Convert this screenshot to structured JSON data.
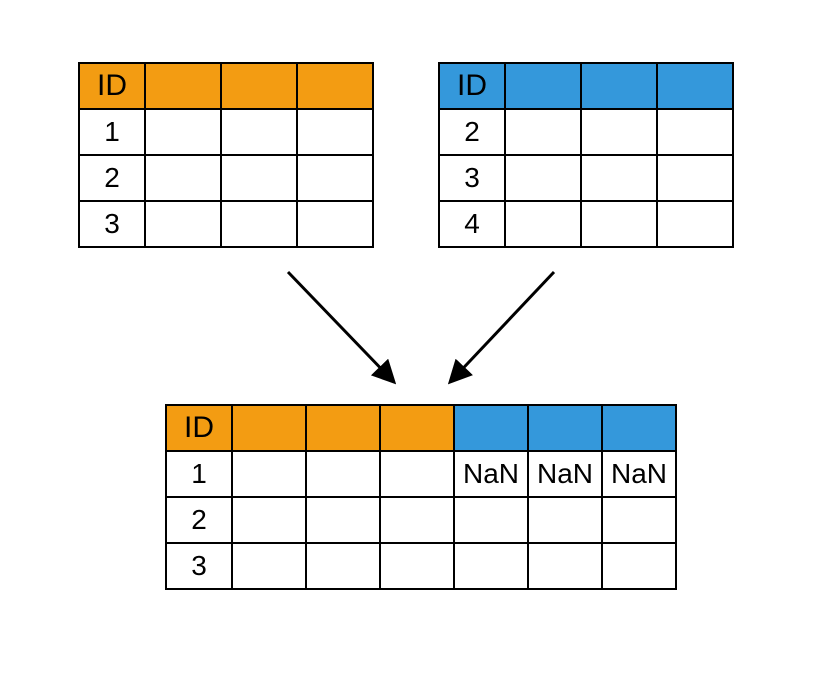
{
  "left_table": {
    "header": [
      "ID",
      "",
      "",
      ""
    ],
    "rows": [
      [
        "1",
        "",
        "",
        ""
      ],
      [
        "2",
        "",
        "",
        ""
      ],
      [
        "3",
        "",
        "",
        ""
      ]
    ]
  },
  "right_table": {
    "header": [
      "ID",
      "",
      "",
      ""
    ],
    "rows": [
      [
        "2",
        "",
        "",
        ""
      ],
      [
        "3",
        "",
        "",
        ""
      ],
      [
        "4",
        "",
        "",
        ""
      ]
    ]
  },
  "result_table": {
    "header": [
      "ID",
      "",
      "",
      "",
      "",
      "",
      ""
    ],
    "rows": [
      [
        "1",
        "",
        "",
        "",
        "NaN",
        "NaN",
        "NaN"
      ],
      [
        "2",
        "",
        "",
        "",
        "",
        "",
        ""
      ],
      [
        "3",
        "",
        "",
        "",
        "",
        "",
        ""
      ]
    ]
  }
}
